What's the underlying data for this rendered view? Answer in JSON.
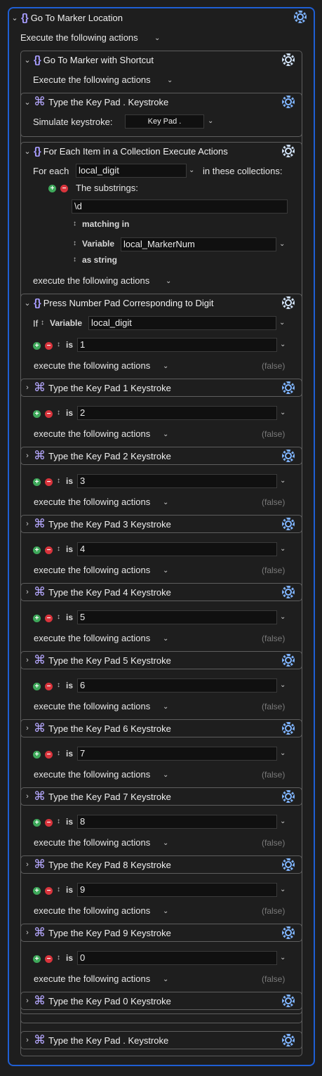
{
  "macro": {
    "title": "Go To Marker Location",
    "execute_label": "Execute the following actions"
  },
  "group1": {
    "title": "Go To Marker with Shortcut",
    "execute_label": "Execute the following actions"
  },
  "keystroke_top": {
    "title": "Type the Key Pad . Keystroke",
    "simulate_label": "Simulate keystroke:",
    "key": "Key Pad ."
  },
  "foreach": {
    "title": "For Each Item in a Collection Execute Actions",
    "for_each_label": "For each",
    "variable": "local_digit",
    "in_collections_label": "in these collections:",
    "substrings_label": "The substrings:",
    "regex": "\\d",
    "matching_in_label": "matching in",
    "variable_label": "Variable",
    "source_variable": "local_MarkerNum",
    "as_string_label": "as string",
    "execute_label": "execute the following actions"
  },
  "switch": {
    "title": "Press Number Pad Corresponding to Digit",
    "if_label": "If",
    "variable_label": "Variable",
    "variable": "local_digit",
    "is_label": "is",
    "execute_label": "execute the following actions",
    "false_label": "(false)",
    "cases": [
      {
        "value": "1",
        "action": "Type the Key Pad 1 Keystroke"
      },
      {
        "value": "2",
        "action": "Type the Key Pad 2 Keystroke"
      },
      {
        "value": "3",
        "action": "Type the Key Pad 3 Keystroke"
      },
      {
        "value": "4",
        "action": "Type the Key Pad 4 Keystroke"
      },
      {
        "value": "5",
        "action": "Type the Key Pad 5 Keystroke"
      },
      {
        "value": "6",
        "action": "Type the Key Pad 6 Keystroke"
      },
      {
        "value": "7",
        "action": "Type the Key Pad 7 Keystroke"
      },
      {
        "value": "8",
        "action": "Type the Key Pad 8 Keystroke"
      },
      {
        "value": "9",
        "action": "Type the Key Pad 9 Keystroke"
      },
      {
        "value": "0",
        "action": "Type the Key Pad 0 Keystroke"
      }
    ]
  },
  "keystroke_bottom": {
    "title": "Type the Key Pad . Keystroke"
  },
  "icons": {
    "group": "curly-braces-icon",
    "keystroke": "command-icon",
    "gear": "gear-icon",
    "accent": "#1f5fd4"
  }
}
